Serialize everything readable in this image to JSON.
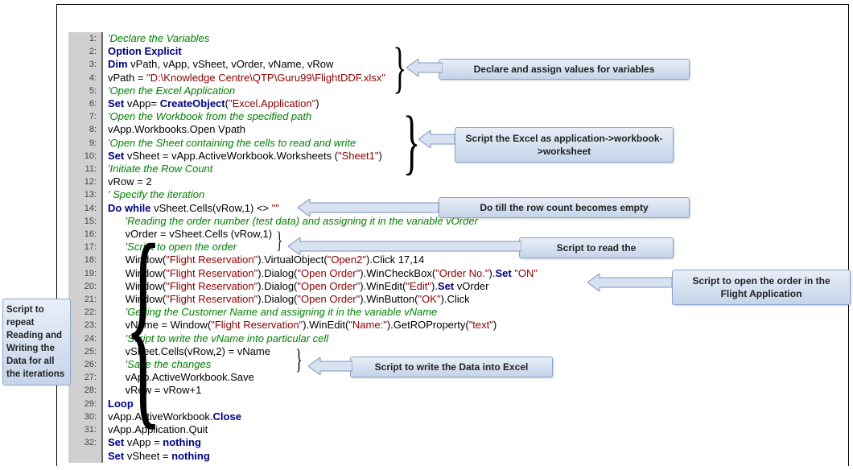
{
  "code_lines": [
    {
      "n": "1:",
      "parts": [
        {
          "cls": "comment",
          "t": "'Declare the Variables"
        }
      ]
    },
    {
      "n": "2:",
      "parts": [
        {
          "cls": "keyword",
          "t": "Option Explicit"
        }
      ]
    },
    {
      "n": "3:",
      "parts": [
        {
          "cls": "keyword",
          "t": "Dim"
        },
        {
          "cls": "text",
          "t": " vPath, vApp, vSheet, vOrder, vName, vRow"
        }
      ]
    },
    {
      "n": "4:",
      "parts": [
        {
          "cls": "text",
          "t": "vPath = "
        },
        {
          "cls": "string",
          "t": "\"D:\\Knowledge Centre\\QTP\\Guru99\\FlightDDF.xlsx\""
        }
      ]
    },
    {
      "n": "5:",
      "parts": [
        {
          "cls": "comment",
          "t": "'Open the Excel Application"
        }
      ]
    },
    {
      "n": "6:",
      "parts": [
        {
          "cls": "keyword",
          "t": "Set"
        },
        {
          "cls": "text",
          "t": " vApp= "
        },
        {
          "cls": "keyword",
          "t": "CreateObject"
        },
        {
          "cls": "text",
          "t": "("
        },
        {
          "cls": "string",
          "t": "\"Excel.Application\""
        },
        {
          "cls": "text",
          "t": ")"
        }
      ]
    },
    {
      "n": "7:",
      "parts": [
        {
          "cls": "comment",
          "t": "'Open the Workbook from the specified path"
        }
      ]
    },
    {
      "n": "8:",
      "parts": [
        {
          "cls": "text",
          "t": "vApp.Workbooks.Open Vpath"
        }
      ]
    },
    {
      "n": "9:",
      "parts": [
        {
          "cls": "comment",
          "t": "'Open the Sheet containing the cells to read and write"
        }
      ]
    },
    {
      "n": "10:",
      "parts": [
        {
          "cls": "keyword",
          "t": "Set"
        },
        {
          "cls": "text",
          "t": " vSheet = vApp.ActiveWorkbook.Worksheets ("
        },
        {
          "cls": "string",
          "t": "\"Sheet1\""
        },
        {
          "cls": "text",
          "t": ")"
        }
      ]
    },
    {
      "n": "11:",
      "parts": [
        {
          "cls": "comment",
          "t": "'Initiate the Row Count"
        }
      ]
    },
    {
      "n": "12:",
      "parts": [
        {
          "cls": "text",
          "t": "vRow = 2"
        }
      ]
    },
    {
      "n": "13:",
      "parts": [
        {
          "cls": "comment",
          "t": "' Specify the iteration"
        }
      ]
    },
    {
      "n": "14:",
      "parts": [
        {
          "cls": "keyword",
          "t": "Do while"
        },
        {
          "cls": "text",
          "t": " vSheet.Cells(vRow,1) <> "
        },
        {
          "cls": "string",
          "t": "\"\""
        }
      ]
    },
    {
      "n": "15:",
      "parts": [
        {
          "cls": "text",
          "t": "      "
        },
        {
          "cls": "comment",
          "t": "'Reading the order number (test data) and assigning it in the variable vOrder"
        }
      ]
    },
    {
      "n": "16:",
      "parts": [
        {
          "cls": "text",
          "t": "      vOrder = vSheet.Cells (vRow,1)"
        }
      ]
    },
    {
      "n": "17:",
      "parts": [
        {
          "cls": "text",
          "t": "      "
        },
        {
          "cls": "comment",
          "t": "'Script to open the order"
        }
      ]
    },
    {
      "n": "18:",
      "parts": [
        {
          "cls": "text",
          "t": "      Window("
        },
        {
          "cls": "string",
          "t": "\"Flight Reservation\""
        },
        {
          "cls": "text",
          "t": ").VirtualObject("
        },
        {
          "cls": "string",
          "t": "\"Open2\""
        },
        {
          "cls": "text",
          "t": ").Click 17,14"
        }
      ]
    },
    {
      "n": "19:",
      "parts": [
        {
          "cls": "text",
          "t": "      Window("
        },
        {
          "cls": "string",
          "t": "\"Flight Reservation\""
        },
        {
          "cls": "text",
          "t": ").Dialog("
        },
        {
          "cls": "string",
          "t": "\"Open Order\""
        },
        {
          "cls": "text",
          "t": ").WinCheckBox("
        },
        {
          "cls": "string",
          "t": "\"Order No.\""
        },
        {
          "cls": "text",
          "t": ")."
        },
        {
          "cls": "keyword",
          "t": "Set"
        },
        {
          "cls": "text",
          "t": " "
        },
        {
          "cls": "string",
          "t": "\"ON\""
        }
      ]
    },
    {
      "n": "20:",
      "parts": [
        {
          "cls": "text",
          "t": "      Window("
        },
        {
          "cls": "string",
          "t": "\"Flight Reservation\""
        },
        {
          "cls": "text",
          "t": ").Dialog("
        },
        {
          "cls": "string",
          "t": "\"Open Order\""
        },
        {
          "cls": "text",
          "t": ").WinEdit("
        },
        {
          "cls": "string",
          "t": "\"Edit\""
        },
        {
          "cls": "text",
          "t": ")."
        },
        {
          "cls": "keyword",
          "t": "Set"
        },
        {
          "cls": "text",
          "t": " vOrder"
        }
      ]
    },
    {
      "n": "21:",
      "parts": [
        {
          "cls": "text",
          "t": "      Window("
        },
        {
          "cls": "string",
          "t": "\"Flight Reservation\""
        },
        {
          "cls": "text",
          "t": ").Dialog("
        },
        {
          "cls": "string",
          "t": "\"Open Order\""
        },
        {
          "cls": "text",
          "t": ").WinButton("
        },
        {
          "cls": "string",
          "t": "\"OK\""
        },
        {
          "cls": "text",
          "t": ").Click"
        }
      ]
    },
    {
      "n": "22:",
      "parts": [
        {
          "cls": "text",
          "t": "      "
        },
        {
          "cls": "comment",
          "t": "'Getting the Customer Name and assigning it in the variable vName"
        }
      ]
    },
    {
      "n": "23:",
      "parts": [
        {
          "cls": "text",
          "t": "      vName = Window("
        },
        {
          "cls": "string",
          "t": "\"Flight Reservation\""
        },
        {
          "cls": "text",
          "t": ").WinEdit("
        },
        {
          "cls": "string",
          "t": "\"Name:\""
        },
        {
          "cls": "text",
          "t": ").GetROProperty("
        },
        {
          "cls": "string",
          "t": "\"text\""
        },
        {
          "cls": "text",
          "t": ")"
        }
      ]
    },
    {
      "n": "24:",
      "parts": [
        {
          "cls": "text",
          "t": "      "
        },
        {
          "cls": "comment",
          "t": "'Script to write the vName into particular cell"
        }
      ]
    },
    {
      "n": "25:",
      "parts": [
        {
          "cls": "text",
          "t": "      vSheet.Cells(vRow,2) = vName"
        }
      ]
    },
    {
      "n": "26:",
      "parts": [
        {
          "cls": "text",
          "t": "      "
        },
        {
          "cls": "comment",
          "t": "'Save the changes"
        }
      ]
    },
    {
      "n": "27:",
      "parts": [
        {
          "cls": "text",
          "t": "      vApp.ActiveWorkbook.Save"
        }
      ]
    },
    {
      "n": "28:",
      "parts": [
        {
          "cls": "text",
          "t": "      vRow = vRow+1"
        }
      ]
    },
    {
      "n": "29:",
      "parts": [
        {
          "cls": "keyword",
          "t": "Loop"
        }
      ]
    },
    {
      "n": "30:",
      "parts": [
        {
          "cls": "text",
          "t": "vApp.ActiveWorkbook."
        },
        {
          "cls": "keyword",
          "t": "Close"
        }
      ]
    },
    {
      "n": "31:",
      "parts": [
        {
          "cls": "text",
          "t": "vApp.Application.Quit"
        }
      ]
    },
    {
      "n": "32:",
      "parts": [
        {
          "cls": "keyword",
          "t": "Set"
        },
        {
          "cls": "text",
          "t": " vApp = "
        },
        {
          "cls": "keyword2",
          "t": "nothing"
        }
      ]
    },
    {
      "n": "",
      "parts": [
        {
          "cls": "keyword",
          "t": "Set"
        },
        {
          "cls": "text",
          "t": " vSheet = "
        },
        {
          "cls": "keyword2",
          "t": "nothing"
        }
      ]
    }
  ],
  "callouts": {
    "declare": "Declare and assign values for variables",
    "excel": "Script the Excel as application->workbook->worksheet",
    "dowhile": "Do till the row count becomes empty",
    "readorder": "Script to read the",
    "openorder": "Script to open the order in the Flight Application",
    "writeexcel": "Script to write the Data into Excel",
    "side": "Script to repeat Reading and Writing the Data for all the iterations"
  }
}
